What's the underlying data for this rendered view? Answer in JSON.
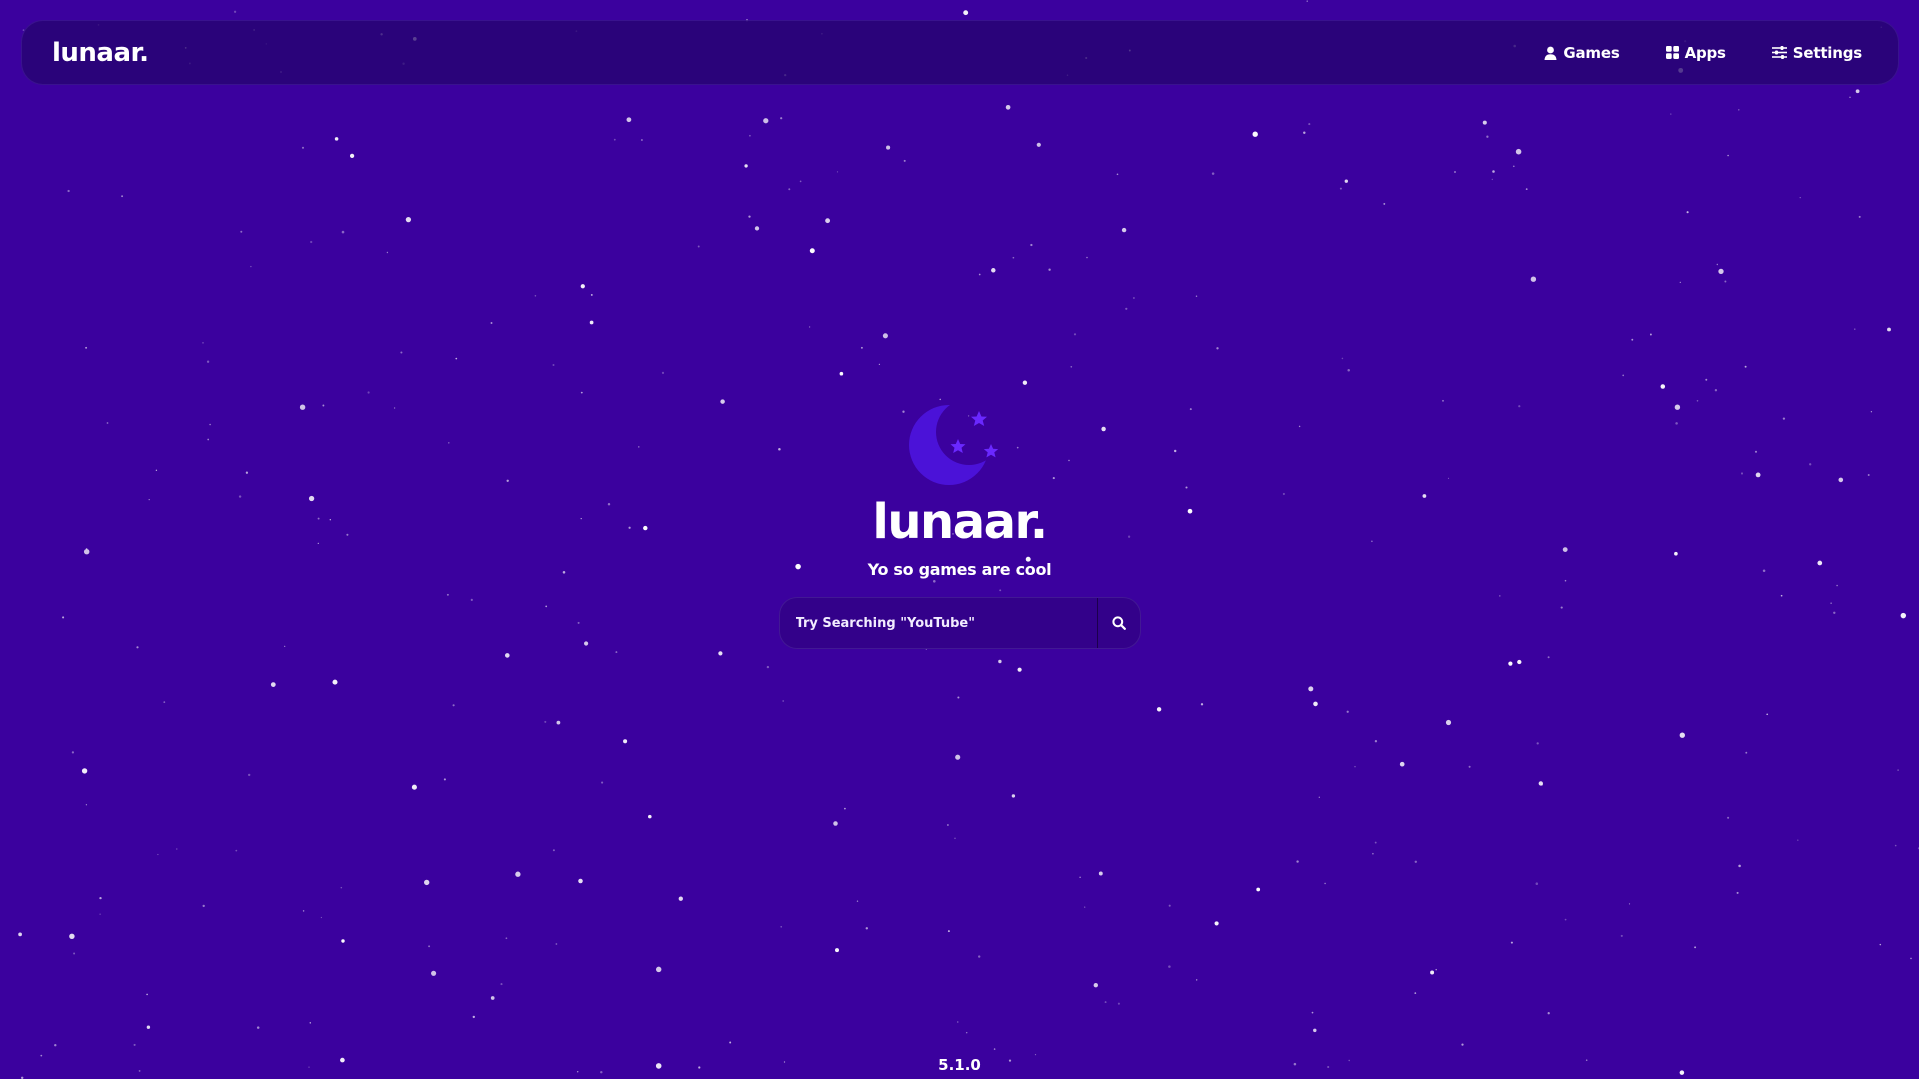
{
  "app": {
    "brand": "lunaar.",
    "version": "5.1.0"
  },
  "nav": {
    "items": [
      {
        "label": "Games",
        "icon": "user-icon"
      },
      {
        "label": "Apps",
        "icon": "grid-icon"
      },
      {
        "label": "Settings",
        "icon": "sliders-icon"
      }
    ]
  },
  "hero": {
    "title": "lunaar.",
    "subtitle": "Yo so games are cool",
    "logo_icon": "moon-stars-icon"
  },
  "search": {
    "placeholder": "Try Searching \"YouTube\"",
    "value": "",
    "button_icon": "search-icon"
  },
  "colors": {
    "background": "#3b019e",
    "navbar": "#24046c",
    "search_bg": "#33018a",
    "moon": "#4b12d8",
    "star_accent": "#6a28ff",
    "text": "#ffffff"
  }
}
